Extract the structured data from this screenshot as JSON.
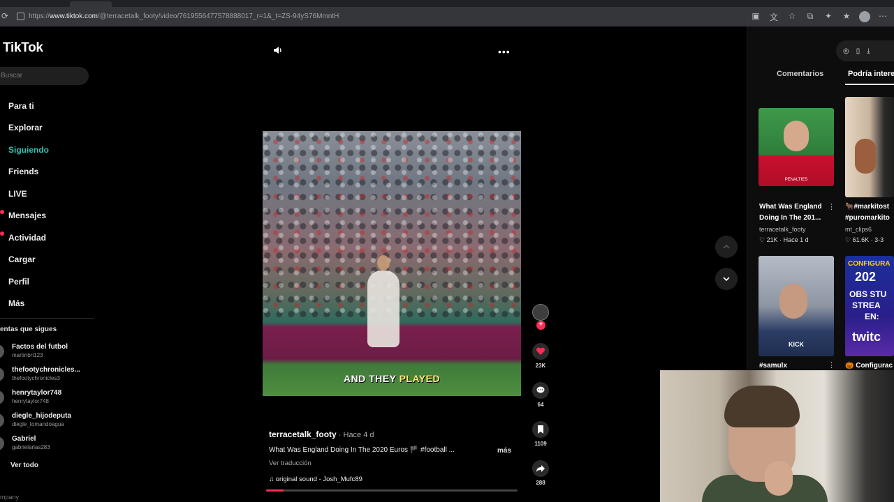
{
  "browser": {
    "url_prefix": "https://",
    "url_host": "www.tiktok.com",
    "url_path": "/@terracetalk_footy/video/7619556477578888017_r=1&_t=ZS-94yS76MmntH"
  },
  "sidebar": {
    "logo": "TikTok",
    "search_placeholder": "Buscar",
    "nav": [
      {
        "label": "Para ti"
      },
      {
        "label": "Explorar"
      },
      {
        "label": "Siguiendo"
      },
      {
        "label": "Friends"
      },
      {
        "label": "LIVE"
      },
      {
        "label": "Mensajes"
      },
      {
        "label": "Actividad"
      },
      {
        "label": "Cargar"
      },
      {
        "label": "Perfil"
      },
      {
        "label": "Más"
      }
    ],
    "following_title": "entas que sigues",
    "accounts": [
      {
        "name": "Factos del futbol",
        "handle": "martinbri123"
      },
      {
        "name": "thefootychronicles...",
        "handle": "thefootychronicles3"
      },
      {
        "name": "henrytaylor748",
        "handle": "henrytaylor748"
      },
      {
        "name": "diegle_hijodeputa",
        "handle": "diegle_tomandoagua"
      },
      {
        "name": "Gabriel",
        "handle": "gabrielarias283"
      }
    ],
    "see_all": "Ver todo",
    "company": "mpany"
  },
  "video": {
    "caption_pre": "AND THEY ",
    "caption_hl": "PLAYED",
    "author": "terracetalk_footy",
    "ago": " · Hace 4 d",
    "description": "What Was England Doing In The 2020 Euros  🏴 #football ...",
    "more": "más",
    "translate": "Ver traducción",
    "sound": "♫  original sound - Josh_Mufc89",
    "progress": 0.07
  },
  "actions": {
    "likes": "23K",
    "comments": "64",
    "saves": "1109",
    "shares": "288",
    "follow_plus": "+"
  },
  "right_panel": {
    "tabs": [
      "Comentarios",
      "Podría intere"
    ],
    "videos": [
      {
        "title1": "What Was England",
        "title2": "Doing In The 201...",
        "author": "terracetalk_footy",
        "stats": "♡ 21K · Hace 1 d",
        "menu": "⋮"
      },
      {
        "title1": "🐂#markitost",
        "title2": "#puromarkito",
        "author": "mt_clips6",
        "stats": "♡ 61.6K · 3-3"
      },
      {
        "title1": "#samulx",
        "menu": "⋮"
      },
      {
        "title1": "🎃 Configurac"
      }
    ],
    "thumb_text": {
      "penalties": "PENALTIES",
      "kick": "KICK",
      "configura": "CONFIGURA",
      "year": "202",
      "obs": "OBS STU",
      "strea": "STREA",
      "en": "EN:",
      "twitc": "twitc"
    }
  },
  "colors": {
    "accent": "#fe2c55",
    "active_nav": "#2ec4b6"
  }
}
